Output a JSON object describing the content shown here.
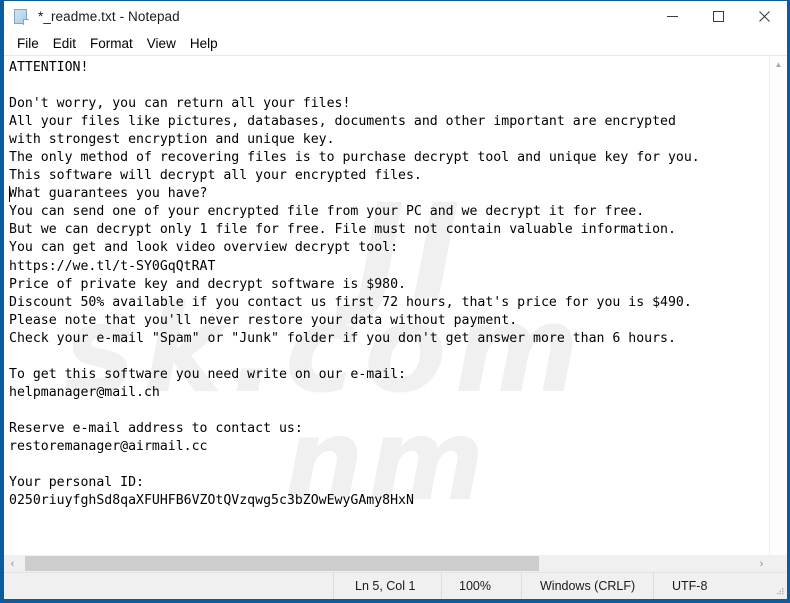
{
  "window": {
    "title": "*_readme.txt - Notepad",
    "icon": "notepad-document-icon",
    "accent_color": "#0a5c9e",
    "caption_buttons": [
      {
        "name": "minimize",
        "label": "Minimize"
      },
      {
        "name": "maximize",
        "label": "Maximize"
      },
      {
        "name": "close",
        "label": "Close"
      }
    ]
  },
  "menubar": {
    "items": [
      {
        "label": "File"
      },
      {
        "label": "Edit"
      },
      {
        "label": "Format"
      },
      {
        "label": "View"
      },
      {
        "label": "Help"
      }
    ]
  },
  "document": {
    "text": "ATTENTION!\n\nDon't worry, you can return all your files!\nAll your files like pictures, databases, documents and other important are encrypted\nwith strongest encryption and unique key.\nThe only method of recovering files is to purchase decrypt tool and unique key for you.\nThis software will decrypt all your encrypted files.\nWhat guarantees you have?\nYou can send one of your encrypted file from your PC and we decrypt it for free.\nBut we can decrypt only 1 file for free. File must not contain valuable information.\nYou can get and look video overview decrypt tool:\nhttps://we.tl/t-SY0GqQtRAT\nPrice of private key and decrypt software is $980.\nDiscount 50% available if you contact us first 72 hours, that's price for you is $490.\nPlease note that you'll never restore your data without payment.\nCheck your e-mail \"Spam\" or \"Junk\" folder if you don't get answer more than 6 hours.\n\nTo get this software you need write on our e-mail:\nhelpmanager@mail.ch\n\nReserve e-mail address to contact us:\nrestoremanager@airmail.cc\n\nYour personal ID:\n0250riuyfghSd8qaXFUHFB6VZOtQVzqwg5c3bZOwEwyGAmy8HxN",
    "video_url": "https://we.tl/t-SY0GqQtRAT",
    "price_full": "$980",
    "price_discounted": "$490",
    "discount_percent": "50%",
    "discount_window_hours": "72",
    "response_time_hours": "6",
    "email_primary": "helpmanager@mail.ch",
    "email_reserve": "restoremanager@airmail.cc",
    "personal_id": "0250riuyfghSd8qaXFUHFB6VZOtQVzqwg5c3bZOwEwyGAmy8HxN"
  },
  "watermark": {
    "line1": "JI",
    "line2": "nm",
    "line3": "sk.com"
  },
  "scrollbars": {
    "vertical": {
      "up_arrow": "▲",
      "down_arrow": "▼"
    },
    "horizontal": {
      "left_arrow": "‹",
      "right_arrow": "›"
    }
  },
  "statusbar": {
    "cursor_position": "Ln 5, Col 1",
    "zoom": "100%",
    "line_ending": "Windows (CRLF)",
    "encoding": "UTF-8"
  }
}
